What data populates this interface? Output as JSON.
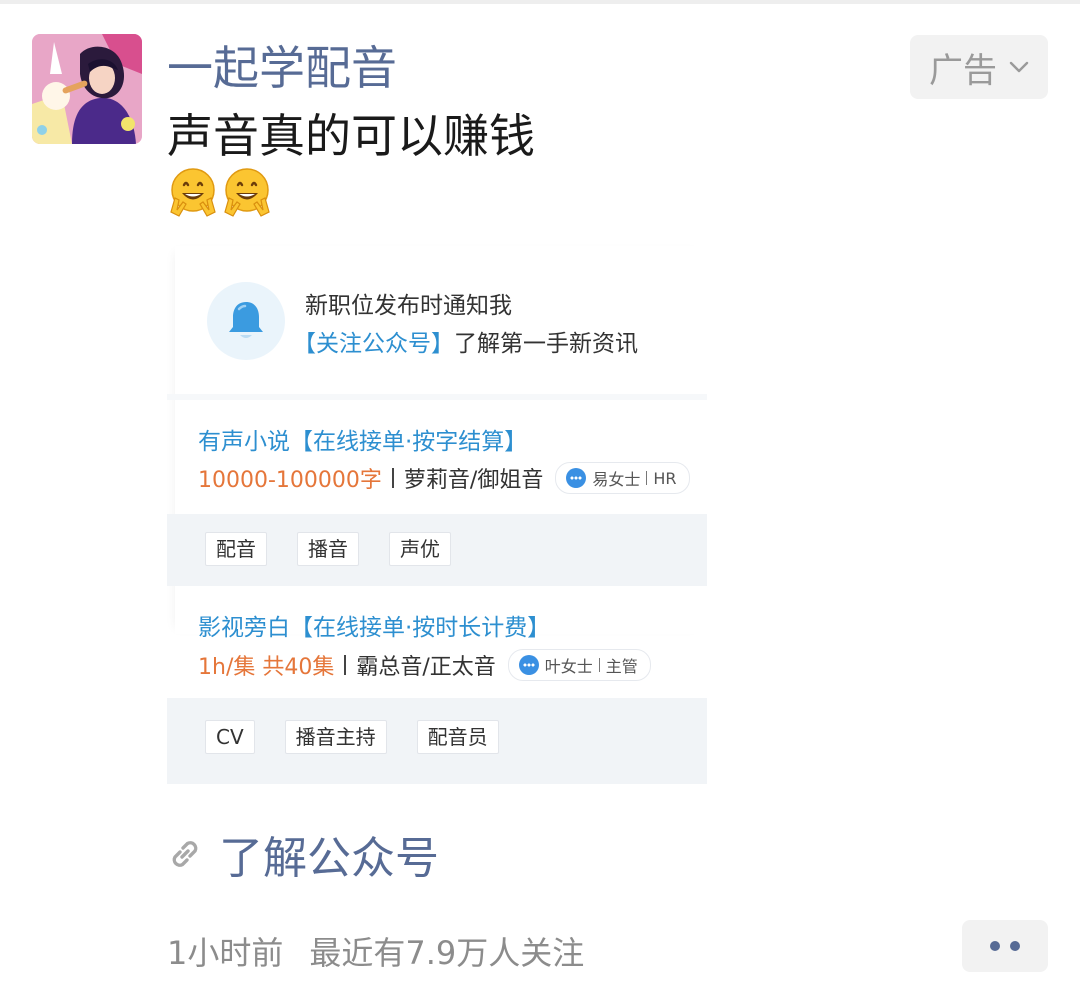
{
  "post": {
    "account_name": "一起学配音",
    "text": "声音真的可以赚钱",
    "emojis": [
      "smile-peace-emoji",
      "smile-peace-emoji"
    ],
    "ad_label": "广告"
  },
  "card": {
    "notify": {
      "title": "新职位发布时通知我",
      "follow_label": "【关注公众号】",
      "follow_desc": "了解第一手新资讯"
    },
    "jobs": [
      {
        "title": "有声小说【在线接单·按字结算】",
        "salary": "10000-100000字",
        "voice": "萝莉音/御姐音",
        "contact_name": "易女士",
        "contact_role": "HR",
        "tags": [
          "配音",
          "播音",
          "声优"
        ]
      },
      {
        "title": "影视旁白【在线接单·按时长计费】",
        "salary": "1h/集 共40集",
        "voice": "霸总音/正太音",
        "contact_name": "叶女士",
        "contact_role": "主管",
        "tags": [
          "CV",
          "播音主持",
          "配音员"
        ]
      }
    ]
  },
  "link": {
    "label": "了解公众号"
  },
  "footer": {
    "time": "1小时前",
    "followers": "最近有7.9万人关注"
  },
  "colors": {
    "link_blue": "#576b95",
    "job_blue": "#2d8fd0",
    "salary_orange": "#e5763a"
  }
}
